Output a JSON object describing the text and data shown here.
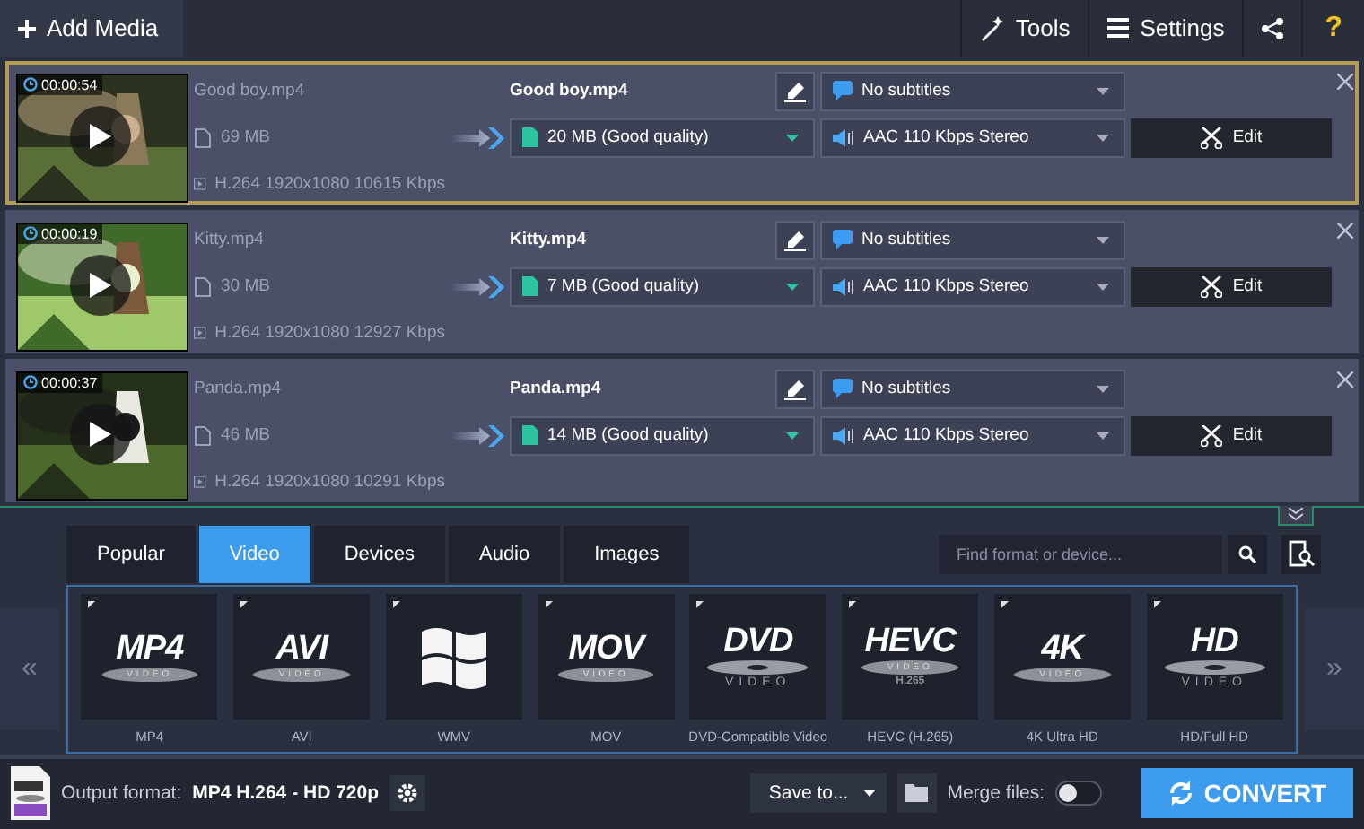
{
  "toolbar": {
    "add_media": "Add Media",
    "tools": "Tools",
    "settings": "Settings",
    "help": "?"
  },
  "files": [
    {
      "duration": "00:00:54",
      "source_name": "Good boy.mp4",
      "source_size": "69 MB",
      "source_info": "H.264 1920x1080 10615 Kbps",
      "output_name": "Good boy.mp4",
      "output_size": "20 MB (Good quality)",
      "subtitles": "No subtitles",
      "audio": "AAC 110 Kbps Stereo",
      "edit": "Edit",
      "selected": true
    },
    {
      "duration": "00:00:19",
      "source_name": "Kitty.mp4",
      "source_size": "30 MB",
      "source_info": "H.264 1920x1080 12927 Kbps",
      "output_name": "Kitty.mp4",
      "output_size": "7 MB (Good quality)",
      "subtitles": "No subtitles",
      "audio": "AAC 110 Kbps Stereo",
      "edit": "Edit",
      "selected": false
    },
    {
      "duration": "00:00:37",
      "source_name": "Panda.mp4",
      "source_size": "46 MB",
      "source_info": "H.264 1920x1080 10291 Kbps",
      "output_name": "Panda.mp4",
      "output_size": "14 MB (Good quality)",
      "subtitles": "No subtitles",
      "audio": "AAC 110 Kbps Stereo",
      "edit": "Edit",
      "selected": false
    }
  ],
  "format_tabs": [
    {
      "label": "Popular",
      "selected": false
    },
    {
      "label": "Video",
      "selected": true
    },
    {
      "label": "Devices",
      "selected": false
    },
    {
      "label": "Audio",
      "selected": false
    },
    {
      "label": "Images",
      "selected": false
    }
  ],
  "search": {
    "placeholder": "Find format or device..."
  },
  "nav_prev": "«",
  "nav_next": "»",
  "formats": [
    {
      "kind": "badge",
      "logo": "MP4",
      "logo_sub": "VIDEO",
      "label": "MP4"
    },
    {
      "kind": "badge",
      "logo": "AVI",
      "logo_sub": "VIDEO",
      "label": "AVI"
    },
    {
      "kind": "windows",
      "label": "WMV"
    },
    {
      "kind": "badge",
      "logo": "MOV",
      "logo_sub": "VIDEO",
      "label": "MOV"
    },
    {
      "kind": "disc",
      "logo": "DVD",
      "logo_sub": "VIDEO",
      "label": "DVD-Compatible Video"
    },
    {
      "kind": "badge",
      "logo": "HEVC",
      "logo_sub": "VIDEO",
      "logo_extra": "H.265",
      "label": "HEVC (H.265)"
    },
    {
      "kind": "badge",
      "logo": "4K",
      "logo_sub": "VIDEO",
      "label": "4K Ultra HD"
    },
    {
      "kind": "disc",
      "logo": "HD",
      "logo_sub": "VIDEO",
      "label": "HD/Full HD"
    }
  ],
  "footer": {
    "output_label": "Output format:",
    "output_value": "MP4 H.264 - HD 720p",
    "save_to": "Save to...",
    "merge_label": "Merge files:",
    "merge_on": false,
    "convert": "CONVERT"
  }
}
